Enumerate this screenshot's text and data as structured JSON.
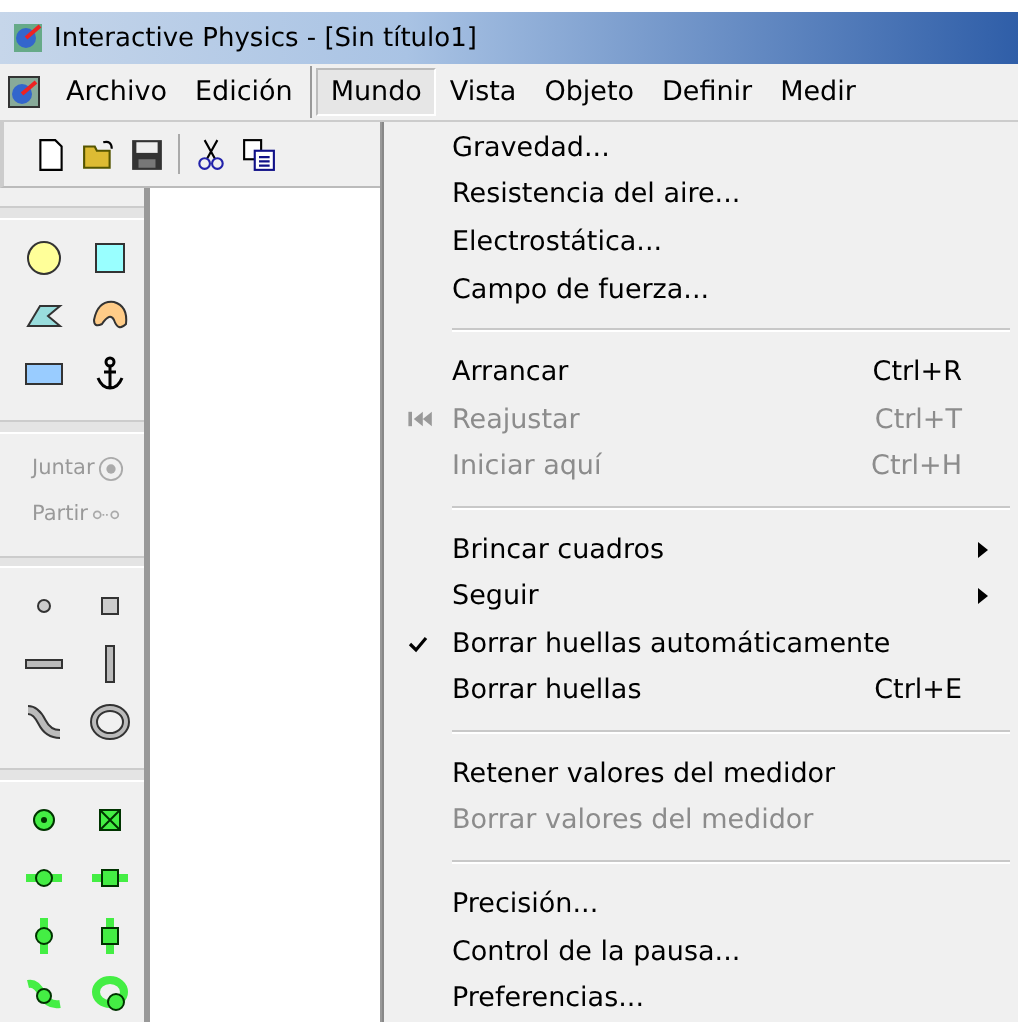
{
  "window": {
    "title": "Interactive Physics - [Sin título1]"
  },
  "menubar": [
    {
      "label": "Archivo",
      "selected": false
    },
    {
      "label": "Edición",
      "selected": false
    },
    {
      "label": "Mundo",
      "selected": true
    },
    {
      "label": "Vista",
      "selected": false
    },
    {
      "label": "Objeto",
      "selected": false
    },
    {
      "label": "Definir",
      "selected": false
    },
    {
      "label": "Medir",
      "selected": false
    }
  ],
  "palette": {
    "joint_buttons": [
      {
        "label": "Juntar",
        "disabled": true
      },
      {
        "label": "Partir",
        "disabled": true
      }
    ]
  },
  "menu": [
    {
      "kind": "item",
      "label": "Gravedad...",
      "disabled": false,
      "checked": false,
      "submenu": false
    },
    {
      "kind": "item",
      "label": "Resistencia del aire...",
      "disabled": false,
      "checked": false,
      "submenu": false
    },
    {
      "kind": "item",
      "label": "Electrostática...",
      "disabled": false,
      "checked": false,
      "submenu": false
    },
    {
      "kind": "item",
      "label": "Campo de fuerza...",
      "disabled": false,
      "checked": false,
      "submenu": false
    },
    {
      "kind": "separator"
    },
    {
      "kind": "item",
      "label": "Arrancar",
      "shortcut": "Ctrl+R",
      "disabled": false,
      "checked": false,
      "submenu": false
    },
    {
      "kind": "icon_item",
      "label": "Reajustar",
      "shortcut": "Ctrl+T",
      "disabled": true,
      "checked": false,
      "submenu": false
    },
    {
      "kind": "item",
      "label": "Iniciar aquí",
      "shortcut": "Ctrl+H",
      "disabled": true,
      "checked": false,
      "submenu": false
    },
    {
      "kind": "separator"
    },
    {
      "kind": "item",
      "label": "Brincar cuadros",
      "disabled": false,
      "checked": false,
      "submenu": true
    },
    {
      "kind": "item",
      "label": "Seguir",
      "disabled": false,
      "checked": false,
      "submenu": true
    },
    {
      "kind": "item",
      "label": "Borrar huellas automáticamente",
      "disabled": false,
      "checked": true,
      "submenu": false
    },
    {
      "kind": "item",
      "label": "Borrar huellas",
      "shortcut": "Ctrl+E",
      "disabled": false,
      "checked": false,
      "submenu": false
    },
    {
      "kind": "separator"
    },
    {
      "kind": "item",
      "label": "Retener valores del medidor",
      "disabled": false,
      "checked": false,
      "submenu": false
    },
    {
      "kind": "item",
      "label": "Borrar valores del medidor",
      "disabled": true,
      "checked": false,
      "submenu": false
    },
    {
      "kind": "separator"
    },
    {
      "kind": "item",
      "label": "Precisión...",
      "disabled": false,
      "checked": false,
      "submenu": false
    },
    {
      "kind": "item",
      "label": "Control de la pausa...",
      "disabled": false,
      "checked": false,
      "submenu": false
    },
    {
      "kind": "item",
      "label": "Preferencias...",
      "disabled": false,
      "checked": false,
      "submenu": false
    }
  ]
}
